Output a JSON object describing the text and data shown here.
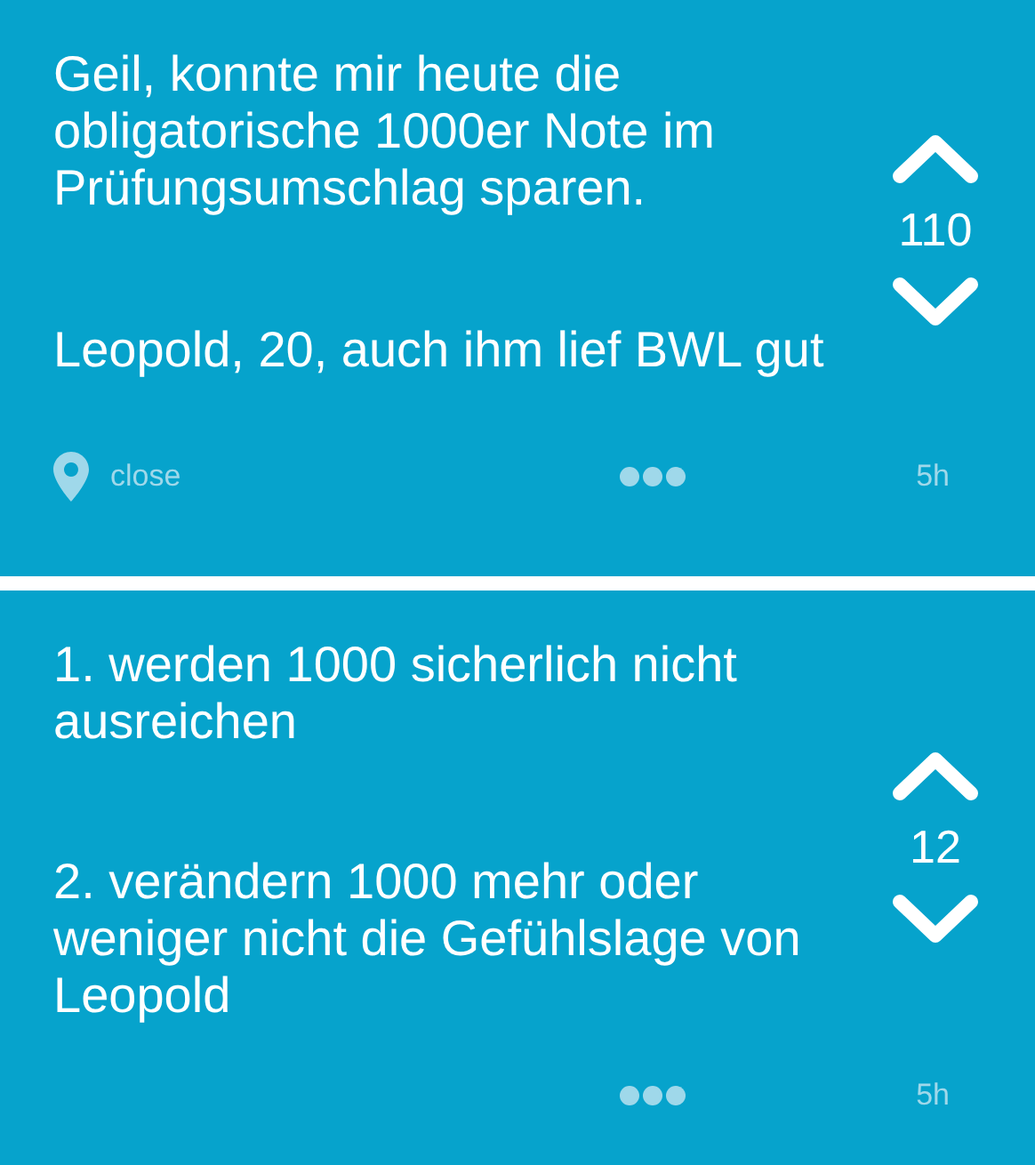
{
  "posts": [
    {
      "paragraphs": [
        "Geil, konnte mir heute die obligatorische 1000er Note im Prüfungsumschlag sparen.",
        "Leopold, 20, auch ihm lief BWL gut"
      ],
      "votes": "110",
      "location": "close",
      "time": "5h"
    },
    {
      "paragraphs": [
        "1. werden 1000 sicherlich nicht ausreichen",
        "2. verändern 1000 mehr oder weniger nicht die Gefühlslage von Leopold"
      ],
      "votes": "12",
      "time": "5h"
    }
  ]
}
